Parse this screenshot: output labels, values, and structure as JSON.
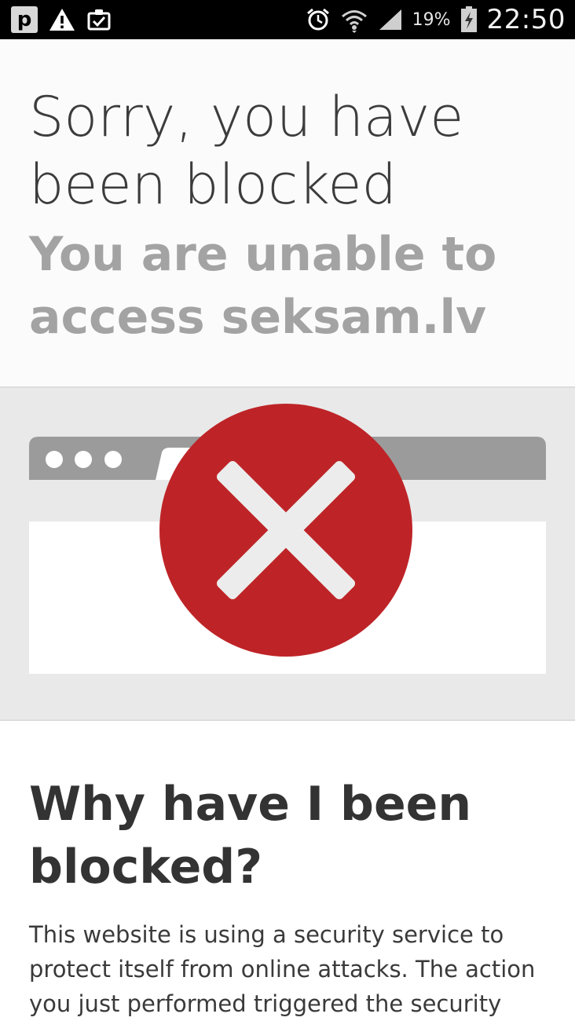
{
  "status_bar": {
    "left_icons": [
      "p-app-icon",
      "warning-icon",
      "clipboard-check-icon"
    ],
    "right_icons": [
      "alarm-icon",
      "wifi-icon",
      "signal-icon",
      "battery-charging-icon"
    ],
    "battery_percent": "19%",
    "time": "22:50"
  },
  "header": {
    "title": "Sorry, you have been blocked",
    "subtitle": "You are unable to access seksam.lv"
  },
  "illustration": {
    "icon": "blocked-x-icon",
    "colors": {
      "circle": "#be2427",
      "browser_bar": "#9b9b9b",
      "browser_body": "#ffffff",
      "band": "#e9e9e9"
    }
  },
  "why": {
    "heading": "Why have I been blocked?",
    "body": "This website is using a security service to protect itself from online attacks. The action you just performed triggered the security"
  }
}
